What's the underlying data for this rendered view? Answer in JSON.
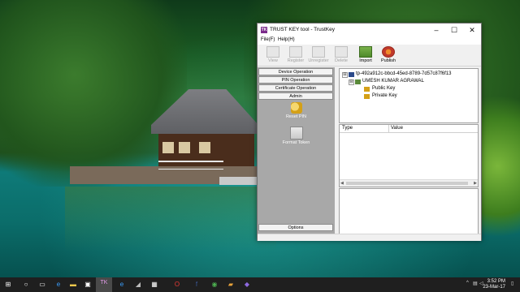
{
  "window": {
    "title": "TRUST KEY tool - TrustKey",
    "title_icon": "TK"
  },
  "menu": [
    "File(F)",
    "Help(H)"
  ],
  "toolbar": [
    {
      "label": "View",
      "icon": "view-icon",
      "enabled": false
    },
    {
      "label": "Register",
      "icon": "register-icon",
      "enabled": false
    },
    {
      "label": "Unregister",
      "icon": "unregister-icon",
      "enabled": false
    },
    {
      "label": "Delete",
      "icon": "delete-icon",
      "enabled": false
    },
    {
      "label": "Import",
      "icon": "import-icon",
      "enabled": true
    },
    {
      "label": "Publish",
      "icon": "publish-icon",
      "enabled": true
    }
  ],
  "nav": {
    "buttons": [
      "Device Operation",
      "PIN Operation",
      "Certificate Operation",
      "Admin"
    ],
    "admin_items": [
      {
        "label": "Reset PIN",
        "icon": "key-icon"
      },
      {
        "label": "Format Token",
        "icon": "token-icon"
      }
    ],
    "options": "Options"
  },
  "tree": {
    "root": "tp-492a912c-bbcd-45ed-8789-7d57c87f6f13",
    "user": "UMESH KUMAR AGRAWAL",
    "children": [
      "Public Key",
      "Private Key"
    ],
    "expanders": [
      "⊟",
      "⊟"
    ]
  },
  "grid": {
    "columns": [
      "Type",
      "Value"
    ]
  },
  "taskbar": {
    "time": "3:52 PM",
    "date": "23-Mar-17",
    "tk_label": "TK"
  }
}
